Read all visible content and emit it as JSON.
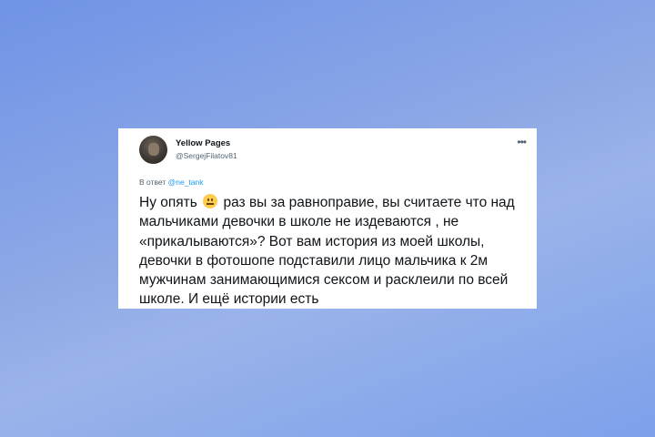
{
  "tweet": {
    "display_name": "Yellow Pages",
    "handle": "@SergejFilatov81",
    "more_icon": "more-horizontal-icon",
    "reply_prefix": "В ответ",
    "reply_to": "@ne_tank",
    "text": {
      "line1_a": "Ну опять",
      "emoji": "neutral-face-emoji",
      "line1_b": "раз вы за равноправие, вы считаете что над",
      "line2": "мальчиками девочки в школе не издеваются , не",
      "line3": "«прикалываются»?  Вот вам история из моей школы,",
      "line4": "девочки в фотошопе подставили лицо мальчика к 2м",
      "line5": "мужчинам занимающимися сексом и расклеили по всей",
      "line6": "школе. И ещё истории есть"
    }
  },
  "colors": {
    "background_accent": "#7da0ea",
    "mention": "#1d9bf0",
    "text_primary": "#0f1419",
    "text_secondary": "#536471"
  }
}
